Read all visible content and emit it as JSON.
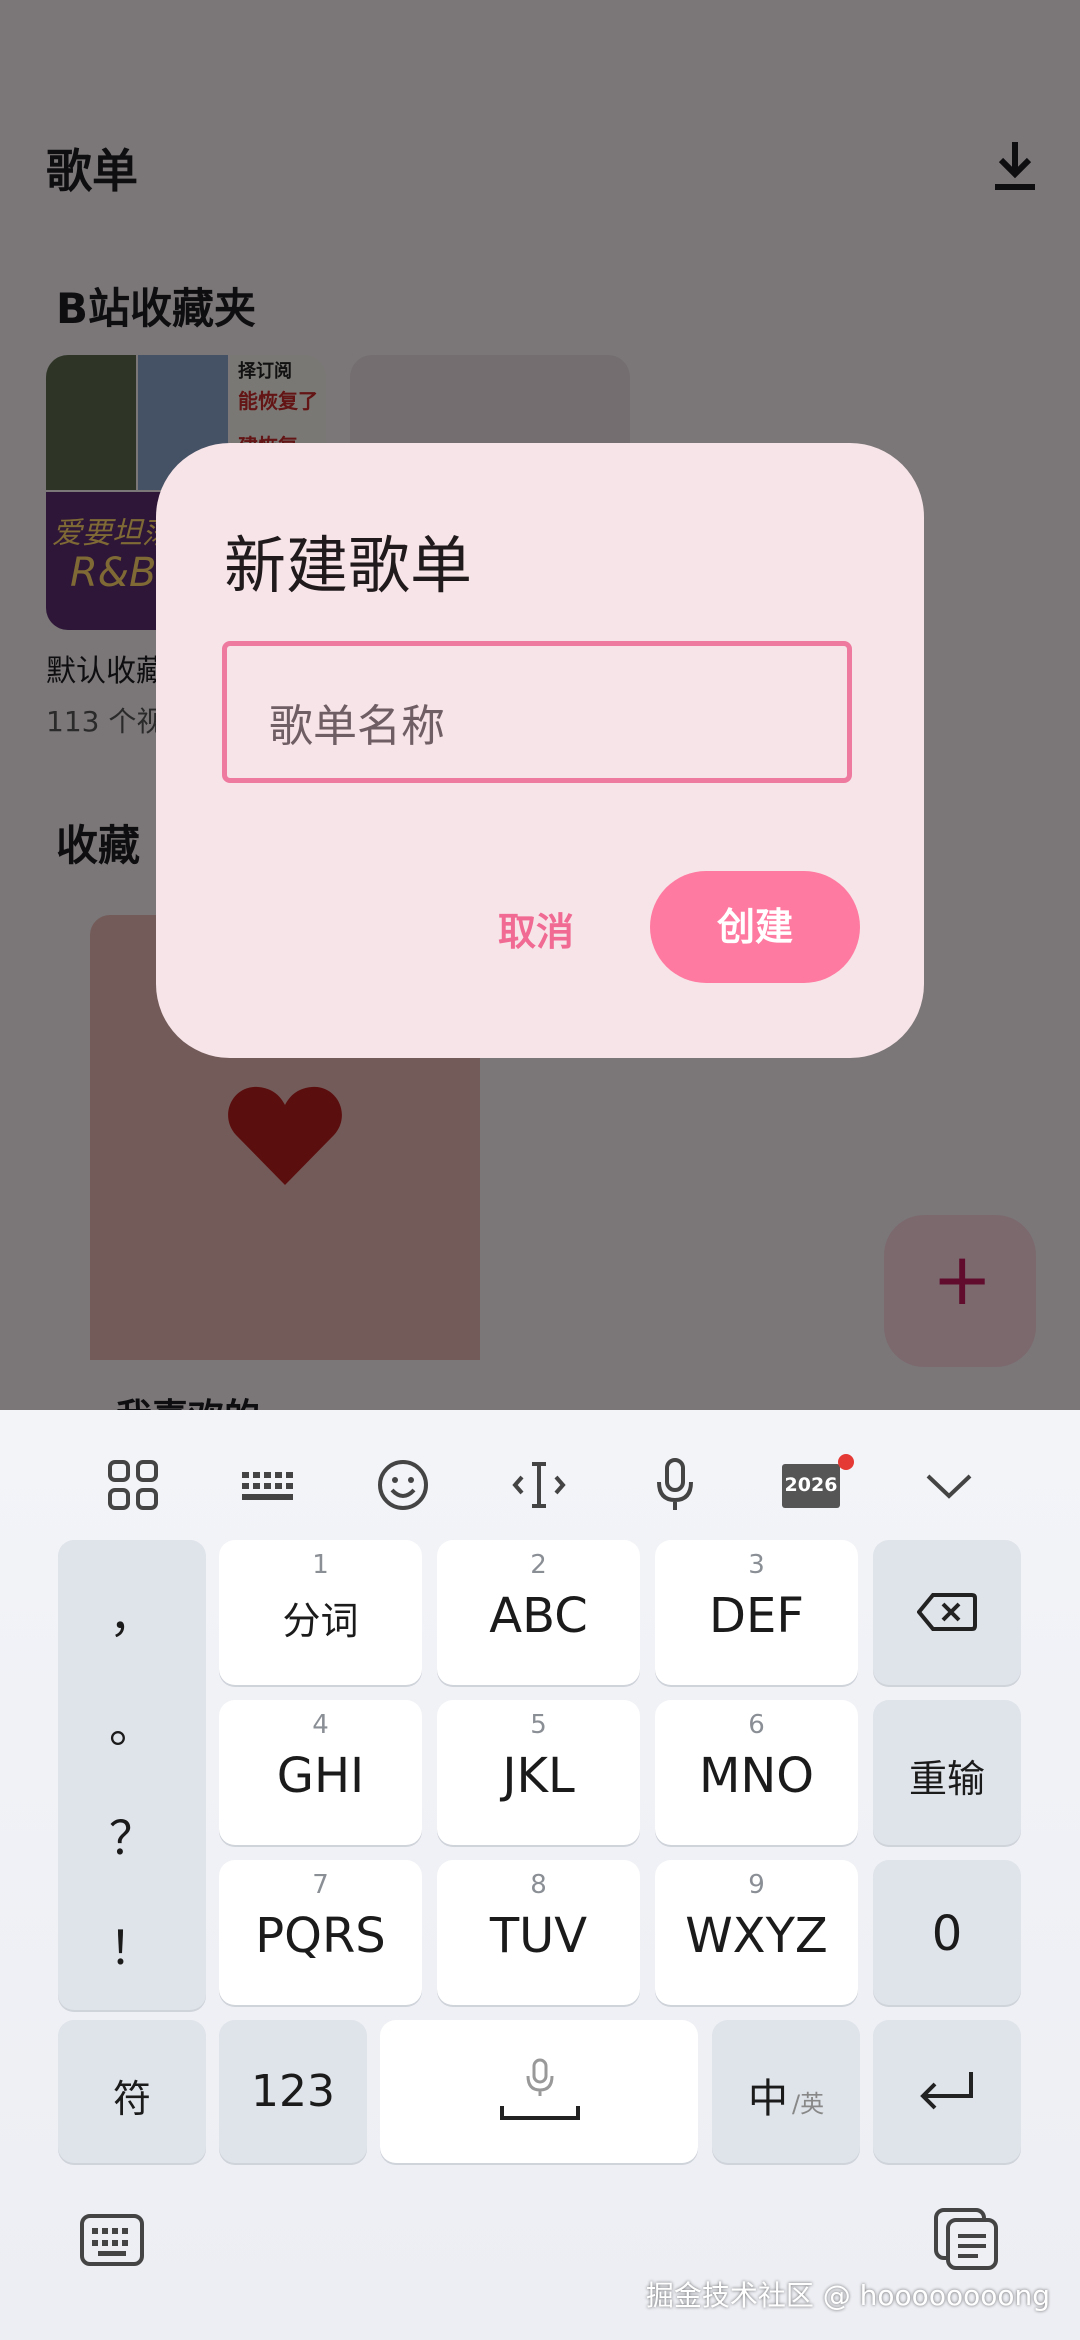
{
  "page": {
    "title": "歌单"
  },
  "bili_section": {
    "title": "B站收藏夹",
    "favorites": {
      "name": "默认收藏",
      "count": "113 个视"
    },
    "cover_texts": [
      "择订阅",
      "能恢复了",
      "建恢复",
      "爱要坦荡",
      "R&B"
    ]
  },
  "collect_section": {
    "title": "收藏",
    "liked": "我喜欢的"
  },
  "fab": {
    "label": "+"
  },
  "dialog": {
    "title": "新建歌单",
    "input_placeholder": "歌单名称",
    "cancel": "取消",
    "create": "创建"
  },
  "keyboard": {
    "toolbar": {
      "icons": [
        "grid-icon",
        "keyboard-layout-icon",
        "emoji-icon",
        "cursor-icon",
        "mic-icon",
        "year-2026-icon",
        "collapse-chevron-icon"
      ],
      "year_badge": "2026"
    },
    "punctuation": [
      "，",
      "。",
      "？",
      "！"
    ],
    "keys": [
      {
        "num": "1",
        "label": "分词"
      },
      {
        "num": "2",
        "label": "ABC"
      },
      {
        "num": "3",
        "label": "DEF"
      },
      {
        "num": "4",
        "label": "GHI"
      },
      {
        "num": "5",
        "label": "JKL"
      },
      {
        "num": "6",
        "label": "MNO"
      },
      {
        "num": "7",
        "label": "PQRS"
      },
      {
        "num": "8",
        "label": "TUV"
      },
      {
        "num": "9",
        "label": "WXYZ"
      }
    ],
    "right_keys": {
      "reinput": "重输",
      "zero": "0"
    },
    "bottom_row": {
      "symbols": "符",
      "numbers": "123",
      "lang_main": "中",
      "lang_alt": "/英"
    }
  },
  "watermark": "掘金技术社区 @ hoooooooong"
}
